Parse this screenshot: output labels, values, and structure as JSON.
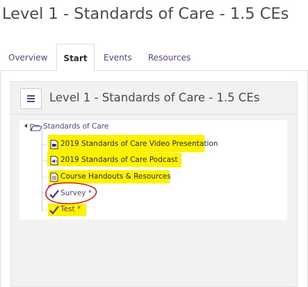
{
  "page": {
    "title": "Level 1 - Standards of Care - 1.5 CEs"
  },
  "tabs": [
    {
      "label": "Overview",
      "active": false
    },
    {
      "label": "Start",
      "active": true
    },
    {
      "label": "Events",
      "active": false
    },
    {
      "label": "Resources",
      "active": false
    }
  ],
  "content": {
    "menu_icon": "hamburger-icon",
    "title": "Level 1 - Standards of Care - 1.5 CEs",
    "tree": {
      "root": {
        "label": "Standards of Care",
        "icon": "open-folder-icon"
      },
      "items": [
        {
          "label": "2019 Standards of Care Video Presentation",
          "icon": "video-file-icon",
          "highlighted": true
        },
        {
          "label": "2019 Standards of Care Podcast",
          "icon": "audio-file-icon",
          "highlighted": true
        },
        {
          "label": "Course Handouts & Resources",
          "icon": "document-icon",
          "highlighted": true
        },
        {
          "label": "Survey *",
          "icon": "checkmark-icon",
          "highlighted": false,
          "circled": true
        },
        {
          "label": "Test *",
          "icon": "checkmark-icon",
          "highlighted": true
        }
      ]
    }
  },
  "colors": {
    "accent": "#5b3f7c",
    "highlight": "#fff200",
    "annotation_circle": "#d42020"
  }
}
